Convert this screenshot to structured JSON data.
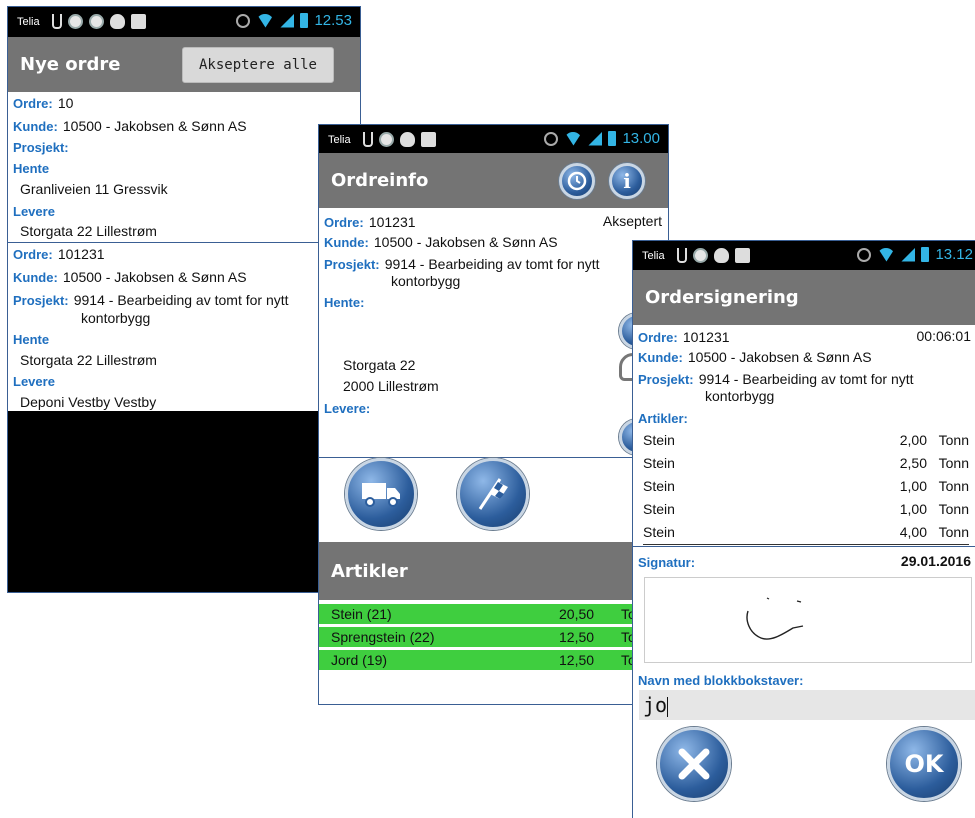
{
  "phone1": {
    "status": {
      "carrier": "Telia",
      "time": "12.53"
    },
    "title": "Nye ordre",
    "accept_all_label": "Akseptere alle",
    "orders": [
      {
        "ordre_label": "Ordre:",
        "ordre": "10",
        "kunde_label": "Kunde:",
        "kunde": "10500 - Jakobsen & Sønn AS",
        "prosjekt_label": "Prosjekt:",
        "prosjekt": "",
        "hente_label": "Hente",
        "hente": "Granliveien 11  Gressvik",
        "levere_label": "Levere",
        "levere": "Storgata 22  Lillestrøm"
      },
      {
        "ordre_label": "Ordre:",
        "ordre": "101231",
        "kunde_label": "Kunde:",
        "kunde": "10500 - Jakobsen & Sønn AS",
        "prosjekt_label": "Prosjekt:",
        "prosjekt_1": "9914 - Bearbeiding av tomt for nytt",
        "prosjekt_2": "kontorbygg",
        "hente_label": "Hente",
        "hente": "Storgata 22  Lillestrøm",
        "levere_label": "Levere",
        "levere": "Deponi Vestby  Vestby"
      }
    ]
  },
  "phone2": {
    "status": {
      "carrier": "Telia",
      "time": "13.00"
    },
    "title": "Ordreinfo",
    "ordre_label": "Ordre:",
    "ordre": "101231",
    "state": "Akseptert",
    "kunde_label": "Kunde:",
    "kunde": "10500 - Jakobsen & Sønn AS",
    "prosjekt_label": "Prosjekt:",
    "prosjekt_1": "9914 - Bearbeiding av tomt for nytt",
    "prosjekt_2": "kontorbygg",
    "hente_label": "Hente:",
    "address_1": "Storgata 22",
    "address_2": "2000  Lillestrøm",
    "levere_label": "Levere:",
    "artikler_title": "Artikler",
    "articles": [
      {
        "name": "Stein (21)",
        "qty": "20,50",
        "unit": "To"
      },
      {
        "name": "Sprengstein (22)",
        "qty": "12,50",
        "unit": "To"
      },
      {
        "name": "Jord (19)",
        "qty": "12,50",
        "unit": "To"
      }
    ]
  },
  "phone3": {
    "status": {
      "carrier": "Telia",
      "time": "13.12"
    },
    "title": "Ordersignering",
    "ordre_label": "Ordre:",
    "ordre": "101231",
    "timer": "00:06:01",
    "kunde_label": "Kunde:",
    "kunde": "10500 - Jakobsen & Sønn AS",
    "prosjekt_label": "Prosjekt:",
    "prosjekt_1": "9914 - Bearbeiding av tomt for nytt",
    "prosjekt_2": "kontorbygg",
    "artikler_label": "Artikler:",
    "articles": [
      {
        "name": "Stein",
        "qty": "2,00",
        "unit": "Tonn"
      },
      {
        "name": "Stein",
        "qty": "2,50",
        "unit": "Tonn"
      },
      {
        "name": "Stein",
        "qty": "1,00",
        "unit": "Tonn"
      },
      {
        "name": "Stein",
        "qty": "1,00",
        "unit": "Tonn"
      },
      {
        "name": "Stein",
        "qty": "4,00",
        "unit": "Tonn"
      }
    ],
    "signatur_label": "Signatur:",
    "date": "29.01.2016",
    "name_label": "Navn med blokkbokstaver:",
    "name_value": "jo",
    "ok_label": "OK"
  },
  "colors": {
    "accent": "#1f6fbf",
    "title_bar": "#747474",
    "article_green": "#3fce3f",
    "status_blue": "#33b5e5"
  }
}
